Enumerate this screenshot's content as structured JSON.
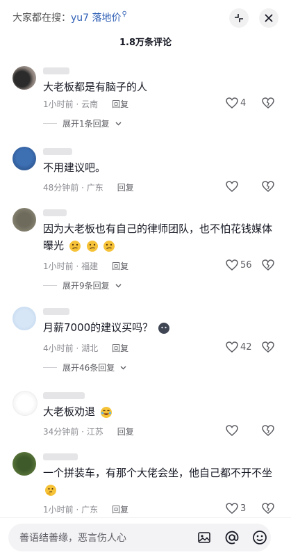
{
  "header": {
    "search_prefix": "大家都在搜：",
    "search_keyword": "yu7 落地价",
    "comment_count_title": "1.8万条评论"
  },
  "comments": [
    {
      "text": "大老板都是有脑子的人",
      "time_location": "1小时前 · 云南",
      "reply_label": "回复",
      "likes": "4",
      "expand": "展开1条回复"
    },
    {
      "text": "不用建议吧。",
      "time_location": "48分钟前 · 广东",
      "reply_label": "回复",
      "likes": ""
    },
    {
      "text": "因为大老板也有自己的律师团队，也不怕花钱媒体曝光",
      "time_location": "1小时前 · 福建",
      "reply_label": "回复",
      "likes": "56",
      "expand": "展开9条回复"
    },
    {
      "text": "月薪7000的建议买吗？",
      "time_location": "4小时前 · 湖北",
      "reply_label": "回复",
      "likes": "42",
      "expand": "展开46条回复"
    },
    {
      "text": "大老板劝退",
      "time_location": "34分钟前 · 江苏",
      "reply_label": "回复",
      "likes": ""
    },
    {
      "text": "一个拼装车，有那个大佬会坐，他自己都不开不坐",
      "time_location": "1小时前 · 广东",
      "reply_label": "回复",
      "likes": "3"
    }
  ],
  "input": {
    "placeholder": "善语结善缘，恶言伤人心"
  },
  "icons": {
    "collapse": "collapse-icon",
    "close": "close-icon",
    "like": "heart-icon",
    "dislike": "broken-heart-icon",
    "image": "image-icon",
    "mention": "at-icon",
    "emoji": "emoji-icon"
  }
}
